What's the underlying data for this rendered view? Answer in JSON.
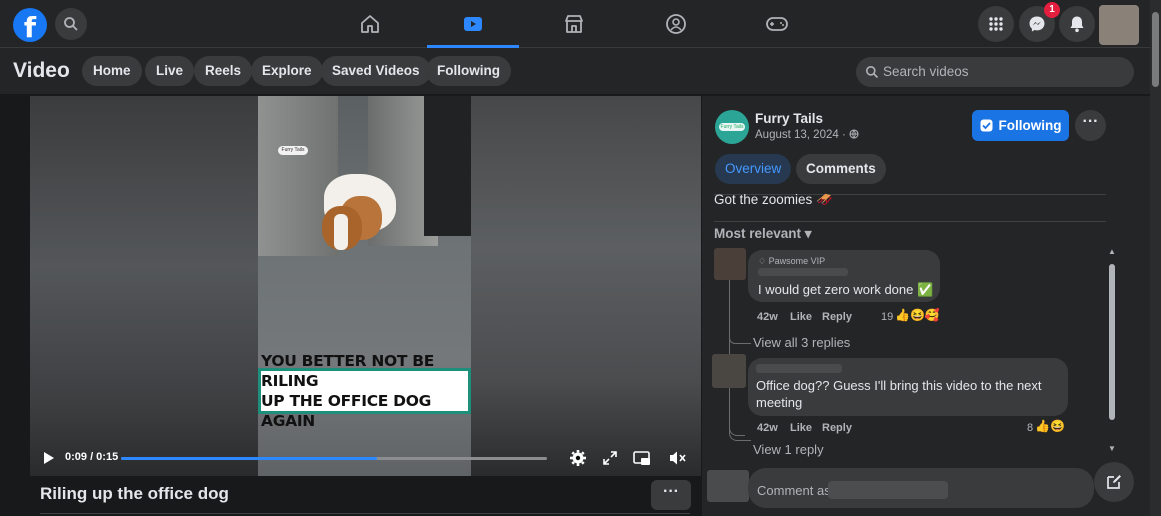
{
  "topbar": {
    "logo": "facebook-logo",
    "notification_count": "1",
    "nav_icons": [
      "home-icon",
      "video-icon",
      "marketplace-icon",
      "groups-icon",
      "gaming-icon"
    ]
  },
  "subnav": {
    "title": "Video",
    "pills": [
      "Home",
      "Live",
      "Reels",
      "Explore",
      "Saved Videos",
      "Following"
    ],
    "search_placeholder": "Search videos"
  },
  "player": {
    "watermark": "Furry Tails",
    "caption_line1": "YOU BETTER NOT BE RILING",
    "caption_line2": "UP THE OFFICE  DOG AGAIN",
    "time": "0:09 / 0:15",
    "progress": 0.6
  },
  "video": {
    "title": "Riling up the office dog",
    "more_label": "···"
  },
  "post": {
    "page_name": "Furry Tails",
    "date": "August 13, 2024 · ",
    "follow_label": "Following",
    "more_label": "···",
    "tabs": [
      "Overview",
      "Comments"
    ],
    "description": "Got the zoomies 🛷",
    "sort_label": "Most relevant ▾"
  },
  "comments": [
    {
      "badge": "Pawsome VIP",
      "text": "I would get zero work done ✅",
      "age": "42w",
      "like": "Like",
      "reply": "Reply",
      "reactions": "19",
      "replies_label": "View all 3 replies"
    },
    {
      "text": "Office dog?? Guess I'll bring this video to the next meeting",
      "age": "42w",
      "like": "Like",
      "reply": "Reply",
      "reactions": "8",
      "replies_label": "View 1 reply"
    }
  ],
  "composer": {
    "placeholder": "Comment as"
  },
  "colors": {
    "accent": "#2d88ff",
    "follow_button": "#1b74e4",
    "caption_border": "#1e8f7a"
  }
}
